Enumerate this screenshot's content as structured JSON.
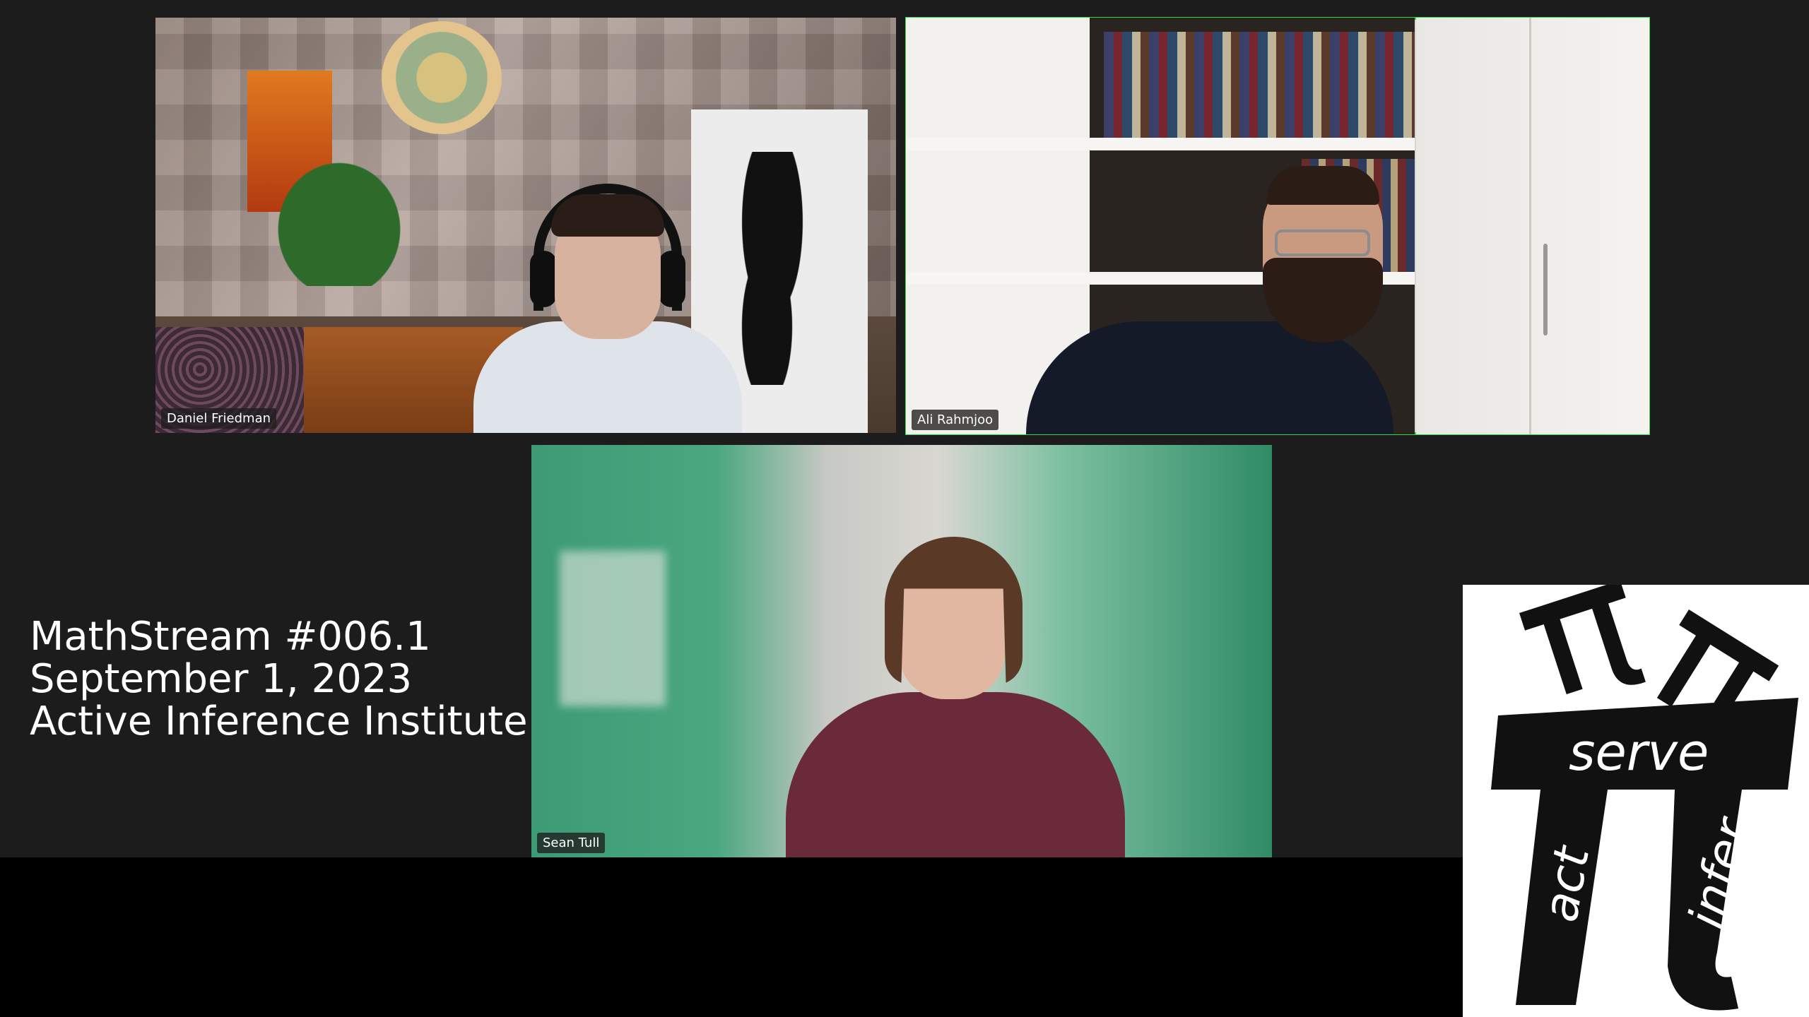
{
  "participants": [
    {
      "name": "Daniel Friedman",
      "active_speaker": false
    },
    {
      "name": "Ali Rahmjoo",
      "active_speaker": true
    },
    {
      "name": "Sean Tull",
      "active_speaker": false
    }
  ],
  "caption": {
    "line1": "MathStream #006.1",
    "line2": "September 1, 2023",
    "line3": "Active Inference Institute"
  },
  "logo": {
    "word_serve": "serve",
    "word_act": "act",
    "word_infer": "infer"
  },
  "colors": {
    "background": "#1c1c1c",
    "active_speaker_outline": "#2fd84a",
    "caption_text": "#ffffff"
  }
}
